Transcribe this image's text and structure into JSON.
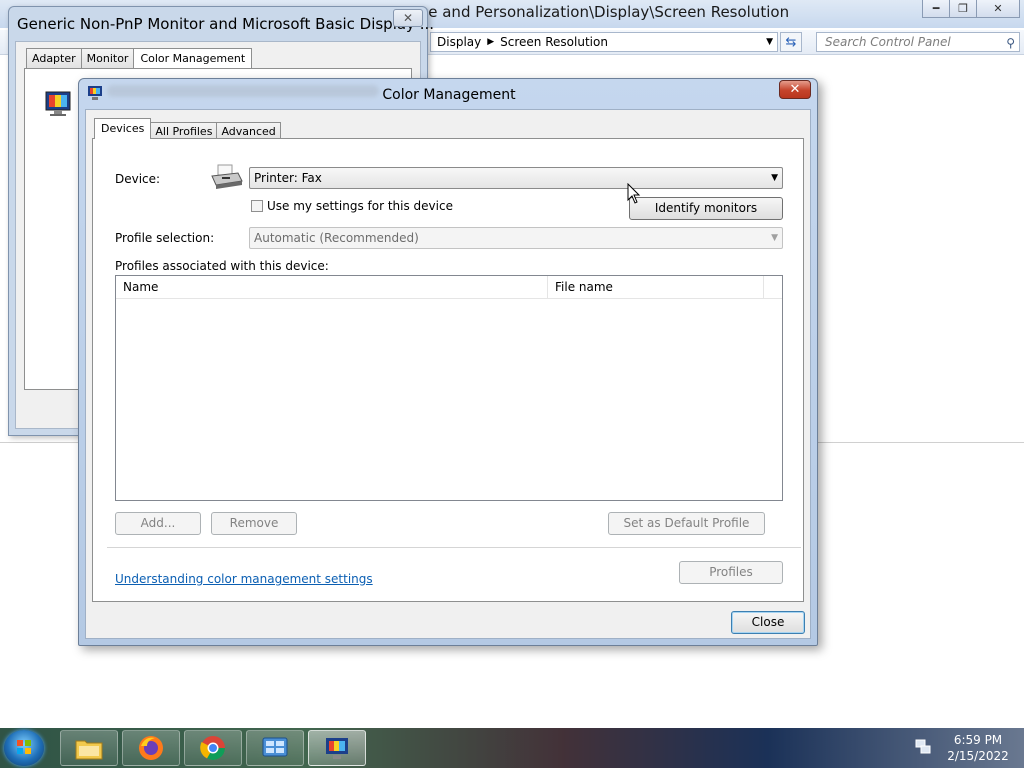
{
  "control_panel": {
    "title": "Control Panel\\Appearance and Personalization\\Display\\Screen Resolution",
    "title_visible": "ce and Personalization\\Display\\Screen Resolution",
    "breadcrumb": [
      "Display",
      "Screen Resolution"
    ],
    "search_placeholder": "Search Control Panel",
    "caption_buttons": [
      "minimize",
      "restore",
      "close"
    ]
  },
  "monitor_window": {
    "title": "Generic Non-PnP Monitor and Microsoft Basic Display ...",
    "tabs": [
      "Adapter",
      "Monitor",
      "Color Management"
    ],
    "active_tab": "Color Management"
  },
  "color_management": {
    "title": "Color Management",
    "tabs": [
      "Devices",
      "All Profiles",
      "Advanced"
    ],
    "active_tab": "Devices",
    "device_label": "Device:",
    "device_value": "Printer: Fax",
    "use_my_settings_label": "Use my settings for this device",
    "use_my_settings_checked": false,
    "identify_monitors_label": "Identify monitors",
    "profile_selection_label": "Profile selection:",
    "profile_selection_value": "Automatic (Recommended)",
    "profiles_associated_label": "Profiles associated with this device:",
    "columns": [
      "Name",
      "File name"
    ],
    "rows": [],
    "add_label": "Add...",
    "remove_label": "Remove",
    "set_default_label": "Set as Default Profile",
    "help_link": "Understanding color management settings",
    "profiles_button": "Profiles",
    "close_button": "Close"
  },
  "taskbar": {
    "time": "6:59 PM",
    "date": "2/15/2022",
    "pinned": [
      "windows-explorer",
      "firefox",
      "chrome",
      "control-panel",
      "color-management"
    ]
  },
  "colors": {
    "link": "#0b5fb3",
    "close_red": "#c5432b",
    "dialog_frame": "#c5d7ee"
  }
}
